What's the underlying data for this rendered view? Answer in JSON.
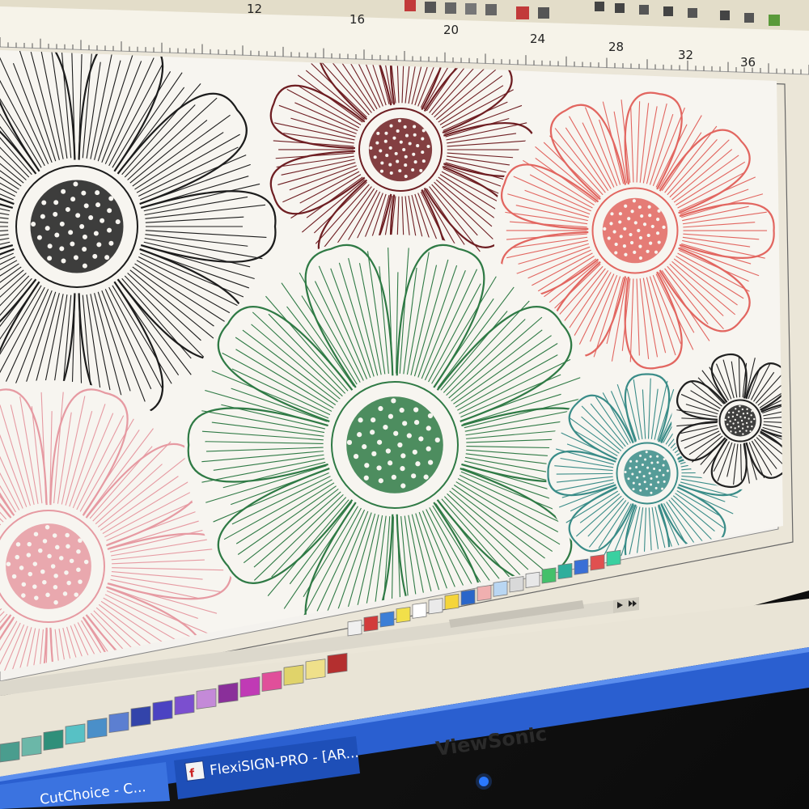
{
  "app": {
    "name": "FlexiSIGN-PRO",
    "taskbar": [
      {
        "label": "CutChoice - C..."
      },
      {
        "label": "FlexiSIGN-PRO - [AR..."
      }
    ]
  },
  "ruler": {
    "labels": [
      "12",
      "16",
      "20",
      "24",
      "28",
      "32",
      "36"
    ]
  },
  "canvas": {
    "flowers": [
      {
        "color": "#1c1c1c"
      },
      {
        "color": "#6e1e22"
      },
      {
        "color": "#e26660"
      },
      {
        "color": "#2f7a45"
      },
      {
        "color": "#e69aa2"
      },
      {
        "color": "#3a8c88"
      },
      {
        "color": "#202020"
      }
    ]
  },
  "palette": {
    "row1": [
      "#4a9d8e",
      "#6bb7a8",
      "#2f8f7a",
      "#57c1c5",
      "#4a8fc9",
      "#5c7fd1",
      "#3344aa",
      "#4b43c2",
      "#7b4fcf",
      "#c48ad8",
      "#8a2f9a",
      "#c03ab5",
      "#e04f9a",
      "#e0d36a",
      "#efe08a",
      "#b42f2f"
    ],
    "row2": [
      "#f0f0f0",
      "#d23b3b",
      "#3d7fd6",
      "#f2e04a",
      "#ffffff",
      "#eaeaea",
      "#f5d53a",
      "#2a66c9",
      "#f0b0b0",
      "#b9d6f2",
      "#d9d9d9",
      "#e8e8e8",
      "#44c06a",
      "#2fae9c",
      "#3a6fd6",
      "#e05050",
      "#3ad0a0"
    ]
  },
  "monitor": {
    "brand": "ViewSonic"
  }
}
